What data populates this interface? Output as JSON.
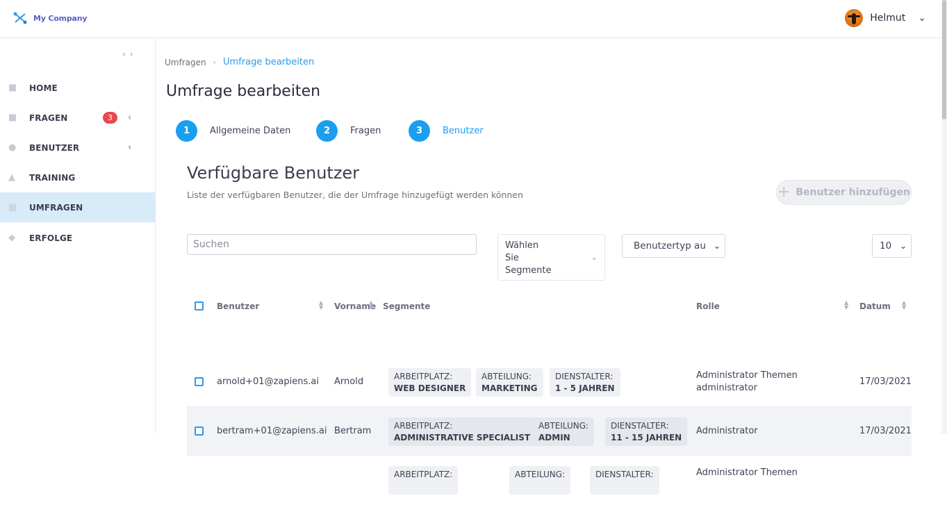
{
  "app": {
    "company": "My Company"
  },
  "user": {
    "name": "Helmut"
  },
  "sidebar": {
    "items": [
      {
        "label": "HOME"
      },
      {
        "label": "FRAGEN",
        "badge": "3"
      },
      {
        "label": "BENUTZER"
      },
      {
        "label": "TRAINING"
      },
      {
        "label": "UMFRAGEN"
      },
      {
        "label": "ERFOLGE"
      }
    ]
  },
  "breadcrumb": {
    "parent": "Umfragen",
    "current": "Umfrage bearbeiten"
  },
  "page": {
    "title": "Umfrage bearbeiten"
  },
  "steps": [
    {
      "num": "1",
      "label": "Allgemeine Daten"
    },
    {
      "num": "2",
      "label": "Fragen"
    },
    {
      "num": "3",
      "label": "Benutzer"
    }
  ],
  "section": {
    "title": "Verfügbare Benutzer",
    "subtitle": "Liste der verfügbaren Benutzer, die der Umfrage hinzugefügt werden können",
    "add_button": "Benutzer hinzufügen"
  },
  "filters": {
    "search_placeholder": "Suchen",
    "segments_placeholder_1": "Wählen",
    "segments_placeholder_2": "Sie",
    "segments_placeholder_3": "Segmente",
    "user_type": "Benutzertyp au",
    "page_size": "10"
  },
  "table": {
    "headers": {
      "user": "Benutzer",
      "firstname": "Vorname",
      "segments": "Segmente",
      "role": "Rolle",
      "date": "Datum"
    },
    "rows": [
      {
        "email": "arnold+01@zapiens.ai",
        "firstname": "Arnold",
        "tags": [
          {
            "k": "ARBEITPLATZ:",
            "v": "WEB DESIGNER"
          },
          {
            "k": "ABTEILUNG:",
            "v": "MARKETING"
          },
          {
            "k": "DIENSTALTER:",
            "v": "1 - 5 JAHREN"
          }
        ],
        "role_1": "Administrator Themen",
        "role_2": "administrator",
        "date": "17/03/2021"
      },
      {
        "email": "bertram+01@zapiens.ai",
        "firstname": "Bertram",
        "tags": [
          {
            "k": "ARBEITPLATZ:",
            "v": "ADMINISTRATIVE SPECIALIST"
          },
          {
            "k": "ABTEILUNG:",
            "v": "ADMIN"
          },
          {
            "k": "DIENSTALTER:",
            "v": "11 - 15 JAHREN"
          }
        ],
        "role_1": "Administrator",
        "date": "17/03/2021"
      },
      {
        "tags": [
          {
            "k": "ARBEITPLATZ:",
            "v": ""
          },
          {
            "k": "ABTEILUNG:",
            "v": ""
          },
          {
            "k": "DIENSTALTER:",
            "v": ""
          }
        ],
        "role_1": "Administrator Themen"
      }
    ]
  },
  "colors": {
    "accent": "#1a9ff0",
    "badge": "#e5484d",
    "active_nav": "#d7ebf9"
  }
}
